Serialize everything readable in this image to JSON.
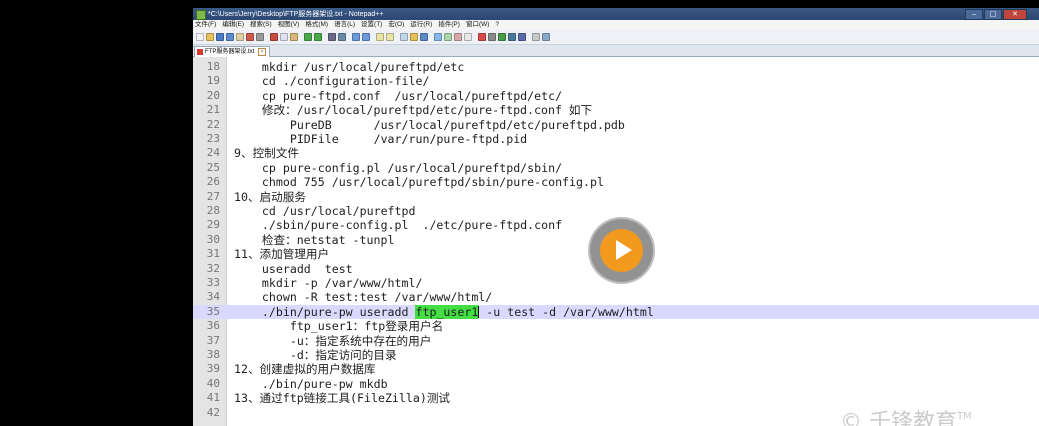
{
  "window": {
    "title": "*C:\\Users\\Jerry\\Desktop\\FTP服务器架设.txt - Notepad++",
    "controls": {
      "minimize": "‒",
      "maximize": "□",
      "close": "✕"
    }
  },
  "menu": [
    "文件(F)",
    "编辑(E)",
    "搜索(S)",
    "视图(V)",
    "格式(M)",
    "语言(L)",
    "设置(T)",
    "宏(O)",
    "运行(R)",
    "插件(P)",
    "窗口(W)",
    "?"
  ],
  "tab": {
    "label": "FTP服务器架设.txt",
    "close": "×"
  },
  "editor": {
    "current_line": 35,
    "lines": [
      {
        "num": "18",
        "text": "    mkdir /usr/local/pureftpd/etc"
      },
      {
        "num": "19",
        "text": "    cd ./configuration-file/"
      },
      {
        "num": "20",
        "text": "    cp pure-ftpd.conf  /usr/local/pureftpd/etc/"
      },
      {
        "num": "21",
        "text": "    修改：/usr/local/pureftpd/etc/pure-ftpd.conf 如下"
      },
      {
        "num": "22",
        "text": "        PureDB      /usr/local/pureftpd/etc/pureftpd.pdb"
      },
      {
        "num": "23",
        "text": "        PIDFile     /var/run/pure-ftpd.pid"
      },
      {
        "num": "24",
        "text": "9、控制文件"
      },
      {
        "num": "25",
        "text": "    cp pure-config.pl /usr/local/pureftpd/sbin/"
      },
      {
        "num": "26",
        "text": "    chmod 755 /usr/local/pureftpd/sbin/pure-config.pl"
      },
      {
        "num": "27",
        "text": "10、启动服务"
      },
      {
        "num": "28",
        "text": "    cd /usr/local/pureftpd"
      },
      {
        "num": "29",
        "text": "    ./sbin/pure-config.pl  ./etc/pure-ftpd.conf"
      },
      {
        "num": "30",
        "text": "    检查：netstat -tunpl"
      },
      {
        "num": "31",
        "text": "11、添加管理用户"
      },
      {
        "num": "32",
        "text": "    useradd  test"
      },
      {
        "num": "33",
        "text": "    mkdir -p /var/www/html/"
      },
      {
        "num": "34",
        "text": "    chown -R test:test /var/www/html/"
      },
      {
        "num": "35",
        "text_before": "    ./bin/pure-pw useradd ",
        "text_highlight": "ftp_user1",
        "text_after": " -u test -d /var/www/html"
      },
      {
        "num": "36",
        "text": "        ftp_user1：ftp登录用户名"
      },
      {
        "num": "37",
        "text": "        -u：指定系统中存在的用户"
      },
      {
        "num": "38",
        "text": "        -d：指定访问的目录"
      },
      {
        "num": "39",
        "text": "12、创建虚拟的用户数据库"
      },
      {
        "num": "40",
        "text": "    ./bin/pure-pw mkdb"
      },
      {
        "num": "41",
        "text": "13、通过ftp链接工具(FileZilla)测试"
      },
      {
        "num": "42",
        "text": ""
      }
    ]
  },
  "watermark": {
    "text": "© 千锋教育",
    "tm": "TM"
  },
  "colors": {
    "current_line_bg": "#dad9ff",
    "selection_highlight": "#44dd44",
    "play_button": "#f39a1e"
  },
  "icons": [
    "play-icon",
    "notepad-app-icon",
    "close-icon",
    "minimize-icon",
    "maximize-icon"
  ]
}
